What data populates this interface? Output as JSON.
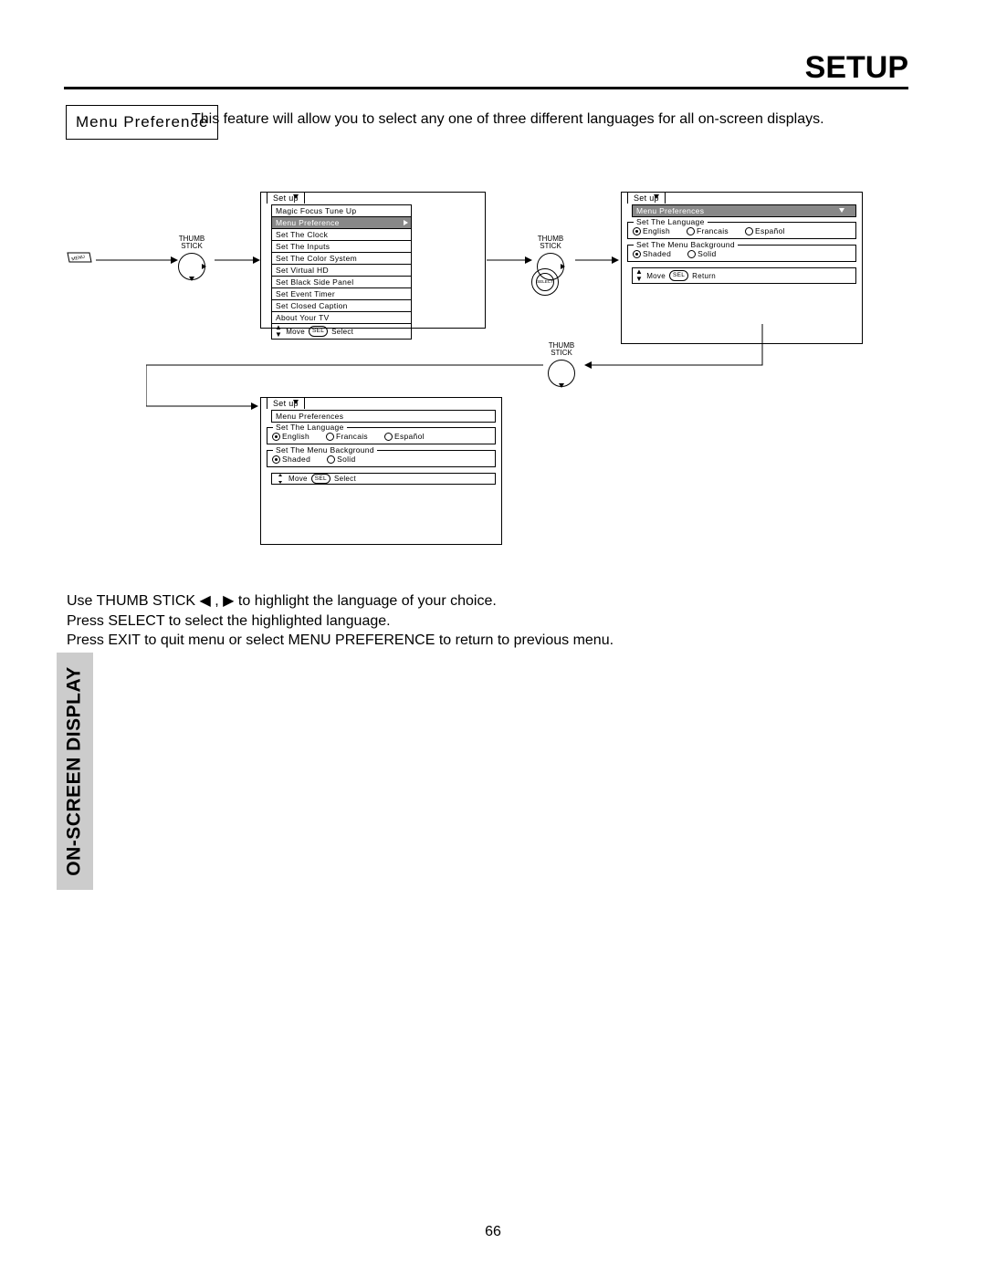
{
  "header": {
    "title": "SETUP"
  },
  "feature": {
    "label": "Menu Preference",
    "description": "This feature will allow you to select any one of three different languages for all on-screen displays."
  },
  "controls": {
    "thumbstick_label_l1": "THUMB",
    "thumbstick_label_l2": "STICK",
    "select_label": "SELECT"
  },
  "screen1": {
    "tab": "Set up",
    "items": [
      "Magic Focus Tune Up",
      "Menu Preference",
      "Set The Clock",
      "Set The Inputs",
      "Set The Color System",
      "Set Virtual HD",
      "Set Black Side Panel",
      "Set Event Timer",
      "Set Closed Caption",
      "About Your TV"
    ],
    "highlighted_index": 1,
    "hint_move": "Move",
    "hint_sel": "SEL",
    "hint_select": "Select"
  },
  "screen2": {
    "tab": "Set up",
    "subheader": "Menu Preferences",
    "lang_fieldset": "Set The Language",
    "bg_fieldset": "Set The Menu Background",
    "langs": [
      "English",
      "Francais",
      "Español"
    ],
    "bgs": [
      "Shaded",
      "Solid"
    ],
    "hint_move": "Move",
    "hint_sel": "SEL",
    "hint_return": "Return"
  },
  "screen3": {
    "tab": "Set up",
    "subheader": "Menu Preferences",
    "lang_fieldset": "Set The Language",
    "bg_fieldset": "Set The Menu Background",
    "langs": [
      "English",
      "Francais",
      "Español"
    ],
    "bgs": [
      "Shaded",
      "Solid"
    ],
    "hint_move": "Move",
    "hint_sel": "SEL",
    "hint_select": "Select"
  },
  "instructions": {
    "l1a": "Use THUMB STICK ",
    "l1b": " , ",
    "l1c": " to highlight the language of your choice.",
    "l2": "Press SELECT to select the highlighted language.",
    "l3": "Press EXIT to quit menu or select MENU PREFERENCE to return to previous menu."
  },
  "sideTab": "ON-SCREEN DISPLAY",
  "pageNumber": "66"
}
